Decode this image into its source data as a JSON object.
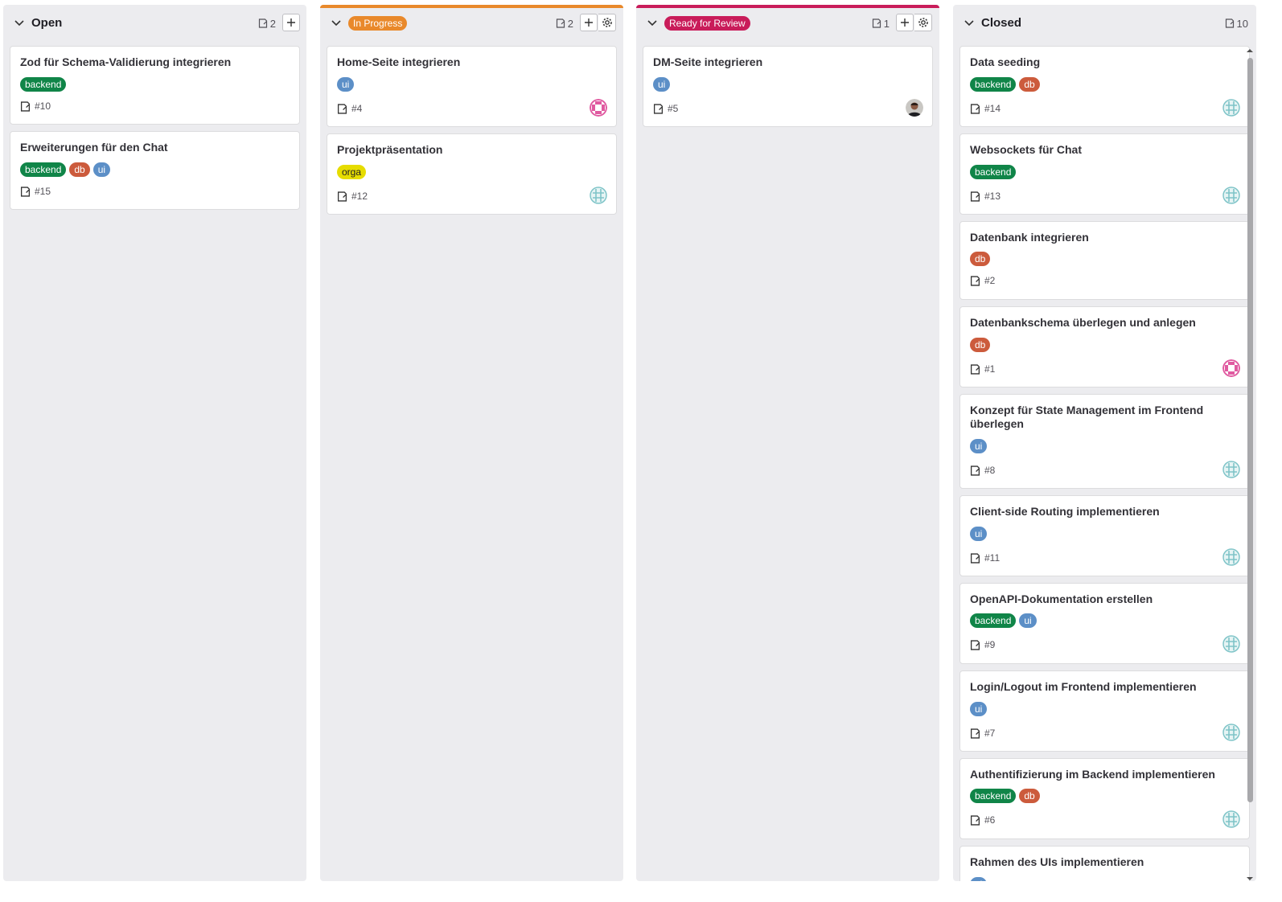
{
  "columns": [
    {
      "title": "Open",
      "count": "2",
      "cards": [
        {
          "title": "Zod für Schema-Validierung integrieren",
          "labels": [
            "backend"
          ],
          "number": "#10",
          "avatar": ""
        },
        {
          "title": "Erweiterungen für den Chat",
          "labels": [
            "backend",
            "db",
            "ui"
          ],
          "number": "#15",
          "avatar": ""
        }
      ]
    },
    {
      "title": "In Progress",
      "count": "2",
      "accent": "#e9892b",
      "cards": [
        {
          "title": "Home-Seite integrieren",
          "labels": [
            "ui"
          ],
          "number": "#4",
          "avatar": "pink-identicon"
        },
        {
          "title": "Projektpräsentation",
          "labels": [
            "orga"
          ],
          "number": "#12",
          "avatar": "teal-identicon"
        }
      ]
    },
    {
      "title": "Ready for Review",
      "count": "1",
      "accent": "#c91c5a",
      "cards": [
        {
          "title": "DM-Seite integrieren",
          "labels": [
            "ui"
          ],
          "number": "#5",
          "avatar": "photo-avatar"
        }
      ]
    },
    {
      "title": "Closed",
      "count": "10",
      "cards": [
        {
          "title": "Data seeding",
          "labels": [
            "backend",
            "db"
          ],
          "number": "#14",
          "avatar": "teal-identicon"
        },
        {
          "title": "Websockets für Chat",
          "labels": [
            "backend"
          ],
          "number": "#13",
          "avatar": "teal-identicon"
        },
        {
          "title": "Datenbank integrieren",
          "labels": [
            "db"
          ],
          "number": "#2",
          "avatar": ""
        },
        {
          "title": "Datenbankschema überlegen und anlegen",
          "labels": [
            "db"
          ],
          "number": "#1",
          "avatar": "pink-identicon"
        },
        {
          "title": "Konzept für State Management im Frontend überlegen",
          "labels": [
            "ui"
          ],
          "number": "#8",
          "avatar": "teal-identicon"
        },
        {
          "title": "Client-side Routing implementieren",
          "labels": [
            "ui"
          ],
          "number": "#11",
          "avatar": "teal-identicon"
        },
        {
          "title": "OpenAPI-Dokumentation erstellen",
          "labels": [
            "backend",
            "ui"
          ],
          "number": "#9",
          "avatar": "teal-identicon"
        },
        {
          "title": "Login/Logout im Frontend implementieren",
          "labels": [
            "ui"
          ],
          "number": "#7",
          "avatar": "teal-identicon"
        },
        {
          "title": "Authentifizierung im Backend implementieren",
          "labels": [
            "backend",
            "db"
          ],
          "number": "#6",
          "avatar": "teal-identicon"
        },
        {
          "title": "Rahmen des UIs implementieren",
          "labels": [
            "ui"
          ],
          "number": "",
          "avatar": ""
        }
      ]
    }
  ],
  "label_colors": {
    "backend": "#108548",
    "db": "#cc5b3c",
    "ui": "#5c8fc7",
    "orga": "#e6dc00"
  },
  "icons": {
    "collapse": "chevron-down-icon",
    "issue": "issue-icon",
    "add": "plus-icon",
    "settings": "gear-icon"
  }
}
